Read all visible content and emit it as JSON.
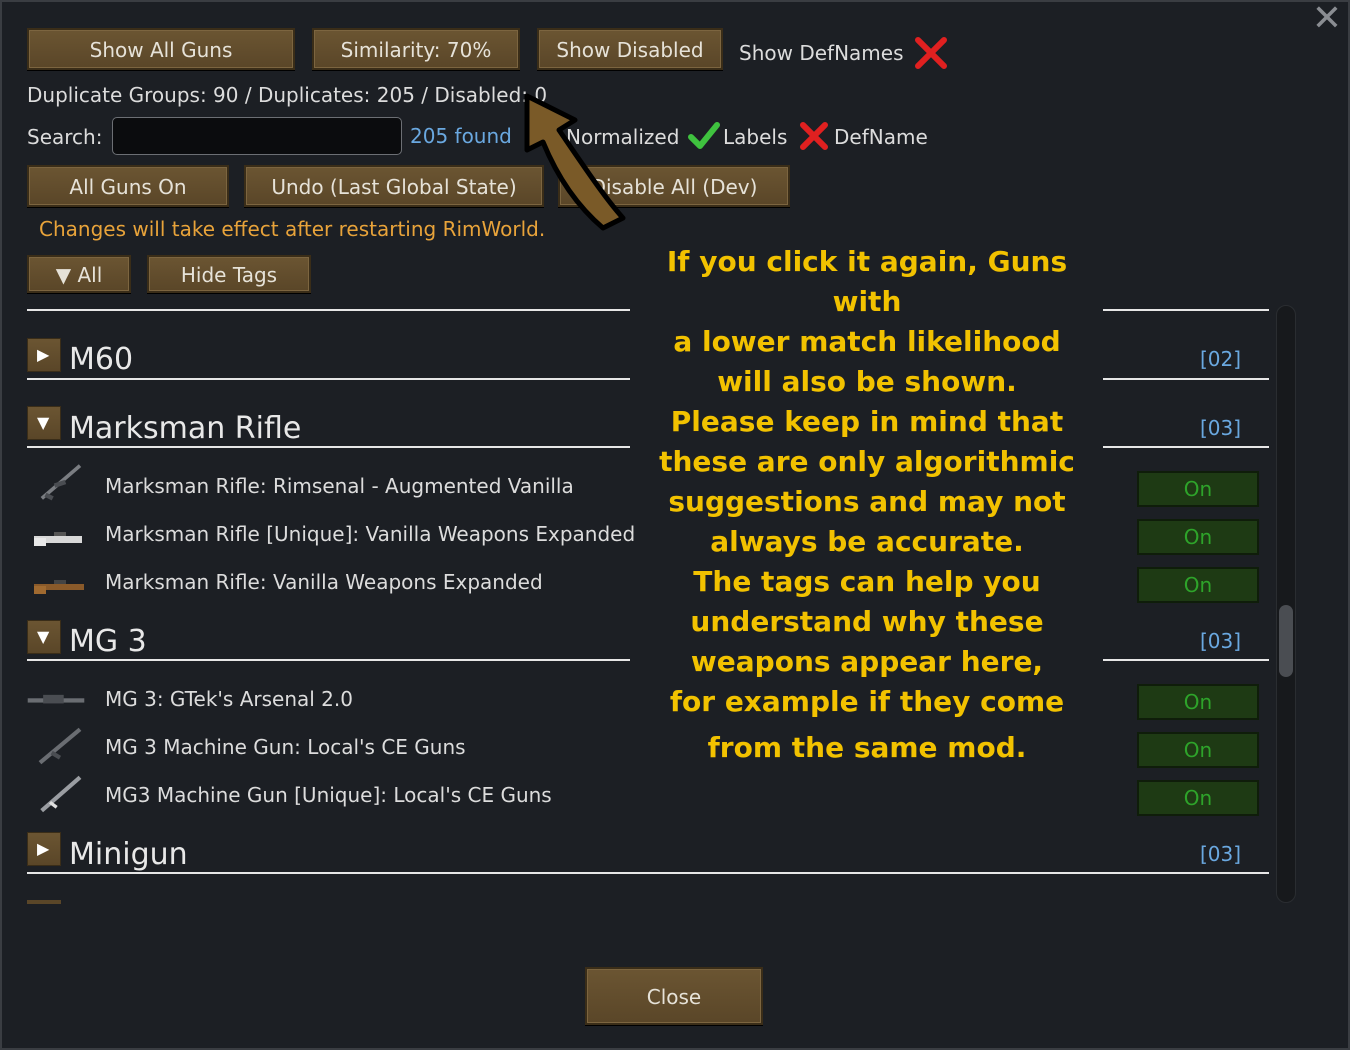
{
  "toolbar": {
    "show_all_guns": "Show All Guns",
    "similarity": "Similarity: 70%",
    "show_disabled": "Show Disabled",
    "show_defnames": "Show DefNames"
  },
  "stats": {
    "text": "Duplicate Groups: 90  /  Duplicates: 205  /  Disabled: 0"
  },
  "search": {
    "label": "Search:",
    "value": "",
    "found": "205 found"
  },
  "filters": {
    "normalized": "Normalized",
    "labels": "Labels",
    "defname": "DefName"
  },
  "actions": {
    "all_guns_on": "All Guns On",
    "undo": "Undo (Last Global State)",
    "disable_all": "Disable All (Dev)"
  },
  "notice": "Changes will take effect after restarting RimWorld.",
  "tag_controls": {
    "all": "All",
    "hide_tags": "Hide Tags"
  },
  "groups": [
    {
      "name": "M60",
      "count": "[02]",
      "expanded": false,
      "items": []
    },
    {
      "name": "Marksman Rifle",
      "count": "[03]",
      "expanded": true,
      "items": [
        {
          "label": "Marksman Rifle: Rimsenal - Augmented Vanilla",
          "state": "On"
        },
        {
          "label": "Marksman Rifle [Unique]: Vanilla Weapons Expanded",
          "state": "On"
        },
        {
          "label": "Marksman Rifle: Vanilla Weapons Expanded",
          "state": "On"
        }
      ]
    },
    {
      "name": "MG 3",
      "count": "[03]",
      "expanded": true,
      "items": [
        {
          "label": "MG 3: GTek's Arsenal 2.0",
          "state": "On"
        },
        {
          "label": "MG 3 Machine Gun: Local's CE Guns",
          "state": "On"
        },
        {
          "label": "MG3 Machine Gun [Unique]: Local's CE Guns",
          "state": "On"
        }
      ]
    },
    {
      "name": "Minigun",
      "count": "[03]",
      "expanded": false,
      "items": []
    }
  ],
  "overlay": {
    "lines": [
      "If you click it again, Guns with",
      "a lower match likelihood",
      "will also be shown.",
      "Please keep in mind that",
      "these are only algorithmic",
      "suggestions and may not",
      "always be accurate.",
      "The tags can help you",
      "understand why these",
      "weapons appear here,",
      "for example if they come",
      "from the same mod."
    ]
  },
  "footer": {
    "close": "Close"
  },
  "colors": {
    "button_brown": "#5a4628",
    "link_blue": "#6aa8e0",
    "warning_orange": "#e8a33a",
    "annotation_yellow": "#f2c200",
    "on_green": "#2ea32a",
    "x_red": "#e02020",
    "check_green": "#3fc23f"
  }
}
